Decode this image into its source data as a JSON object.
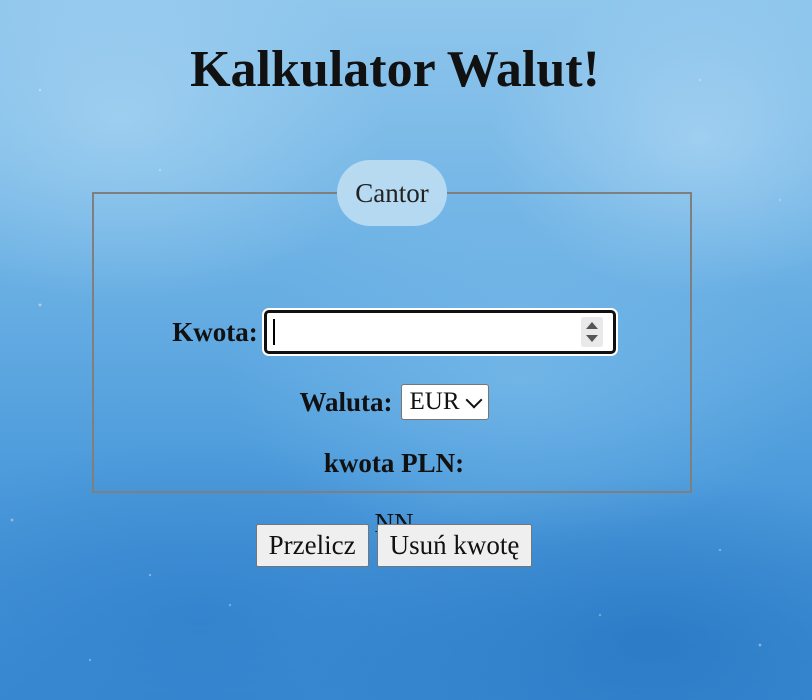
{
  "page": {
    "title": "Kalkulator Walut!"
  },
  "form": {
    "legend": "Cantor",
    "amount_label": "Kwota:",
    "amount_value": "",
    "currency_label": "Waluta:",
    "currency_selected": "EUR",
    "pln_label": "kwota PLN:",
    "result": "NN"
  },
  "buttons": {
    "convert_label": "Przelicz",
    "clear_label": "Usuń kwotę"
  },
  "colors": {
    "background_top": "#8fc6ec",
    "background_bottom": "#3a8ad2",
    "legend_bubble": "#d2e8f5",
    "text": "#111111"
  }
}
